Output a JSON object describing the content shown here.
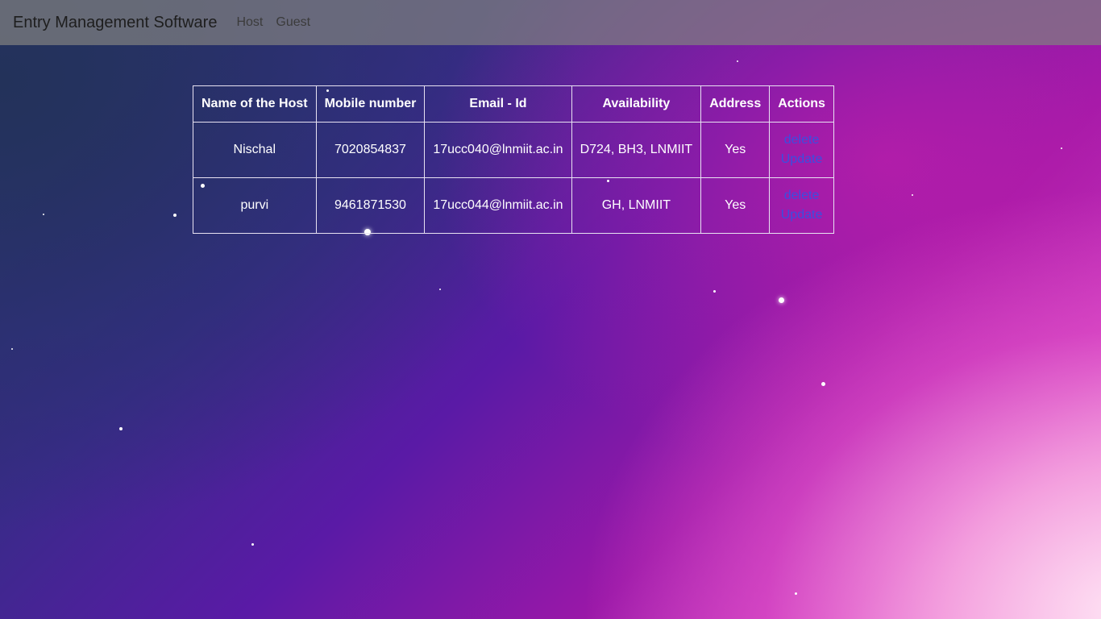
{
  "navbar": {
    "brand": "Entry Management Software",
    "links": [
      "Host",
      "Guest"
    ]
  },
  "table": {
    "headers": [
      "Name of the Host",
      "Mobile number",
      "Email - Id",
      "Availability",
      "Address",
      "Actions"
    ],
    "rows": [
      {
        "name": "Nischal",
        "mobile": "7020854837",
        "email": "17ucc040@lnmiit.ac.in",
        "availability": "D724, BH3, LNMIIT",
        "address": "Yes",
        "actions": [
          "delete",
          "Update"
        ]
      },
      {
        "name": "purvi",
        "mobile": "9461871530",
        "email": "17ucc044@lnmiit.ac.in",
        "availability": "GH, LNMIIT",
        "address": "Yes",
        "actions": [
          "delete",
          "Update"
        ]
      }
    ]
  },
  "colors": {
    "link": "#3a4fe0",
    "navbar_bg": "#808080",
    "table_text": "#ffffff"
  }
}
